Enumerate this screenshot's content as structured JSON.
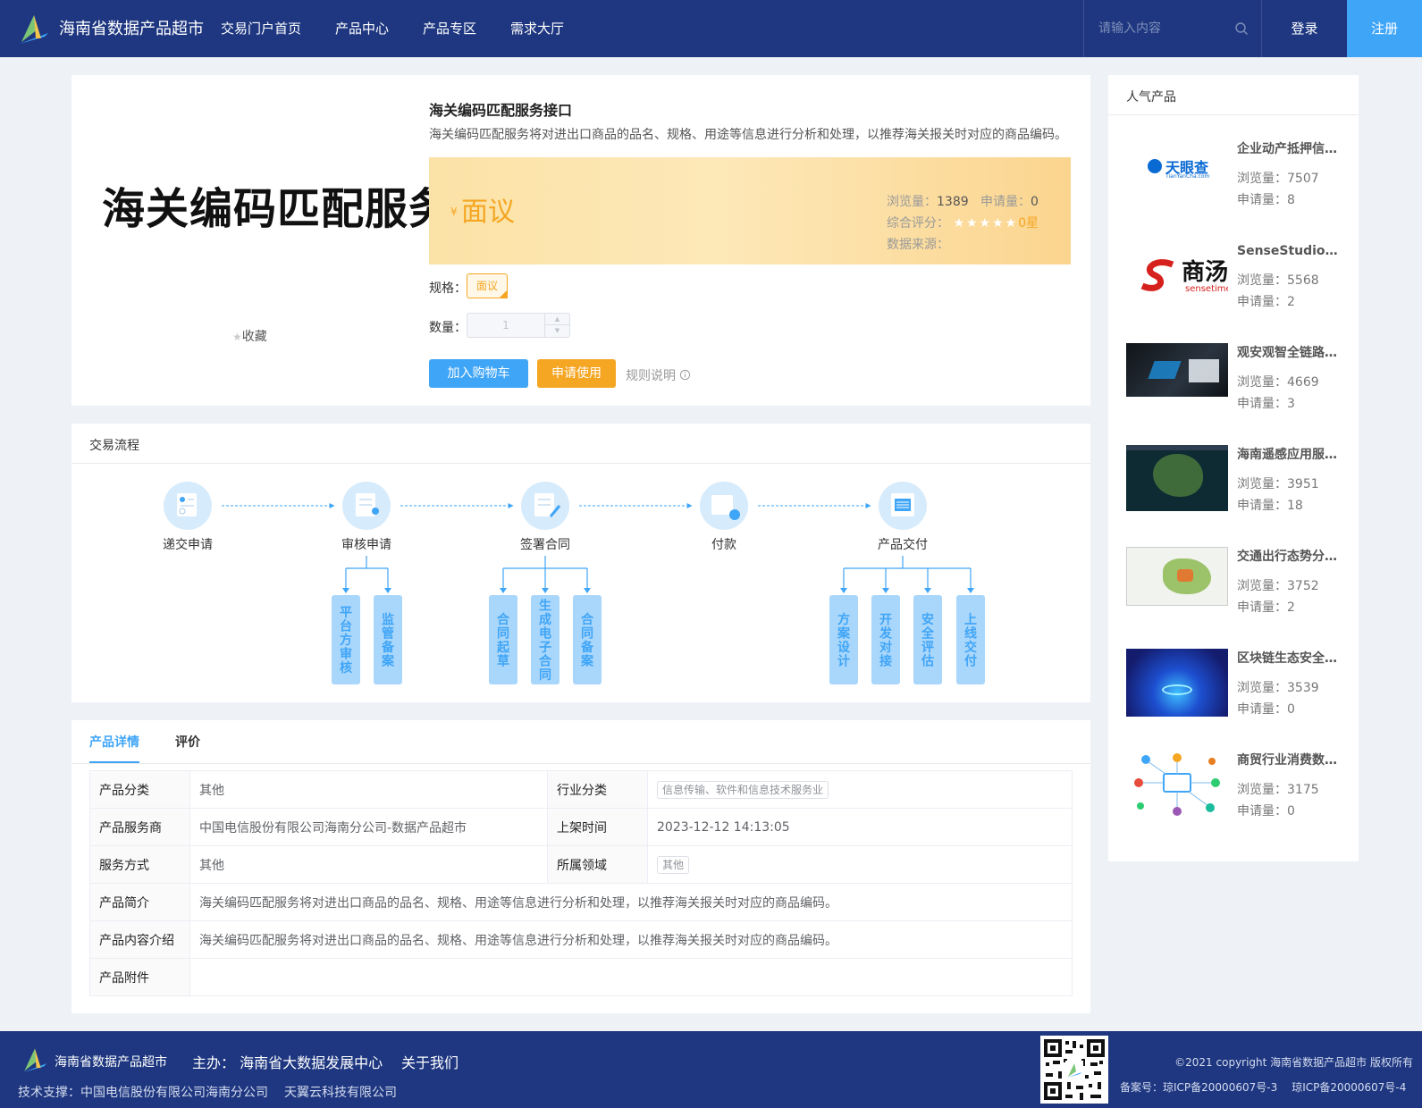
{
  "header": {
    "brand": "海南省数据产品超市",
    "nav": [
      "交易门户首页",
      "产品中心",
      "产品专区",
      "需求大厅"
    ],
    "search_placeholder": "请输入内容",
    "login": "登录",
    "register": "注册"
  },
  "product": {
    "image_text": "海关编码匹配服务",
    "favorite": "收藏",
    "title": "海关编码匹配服务接口",
    "description": "海关编码匹配服务将对进出口商品的品名、规格、用途等信息进行分析和处理，以推荐海关报关时对应的商品编码。",
    "currency": "¥",
    "price": "面议",
    "views_label": "浏览量：",
    "views": "1389",
    "applies_label": "申请量：",
    "applies": "0",
    "rating_label": "综合评分：",
    "stars": "★★★★★",
    "rating": "0星",
    "source_label": "数据来源：",
    "spec_label": "规格：",
    "spec_value": "面议",
    "qty_label": "数量：",
    "qty_value": "1",
    "add_cart": "加入购物车",
    "apply": "申请使用",
    "rules": "规则说明"
  },
  "flow": {
    "title": "交易流程",
    "steps": [
      "递交申请",
      "审核申请",
      "签署合同",
      "付款",
      "产品交付"
    ],
    "sub": {
      "audit": [
        "平台方审核",
        "监管备案"
      ],
      "contract": [
        "合同起草",
        "生成电子合同",
        "合同备案"
      ],
      "deliver": [
        "方案设计",
        "开发对接",
        "安全评估",
        "上线交付"
      ]
    }
  },
  "details": {
    "tabs": [
      "产品详情",
      "评价"
    ],
    "rows": {
      "category_k": "产品分类",
      "category_v": "其他",
      "industry_k": "行业分类",
      "industry_v": "信息传输、软件和信息技术服务业",
      "provider_k": "产品服务商",
      "provider_v": "中国电信股份有限公司海南分公司-数据产品超市",
      "online_k": "上架时间",
      "online_v": "2023-12-12 14:13:05",
      "mode_k": "服务方式",
      "mode_v": "其他",
      "domain_k": "所属领域",
      "domain_v": "其他",
      "intro_k": "产品简介",
      "intro_v": "海关编码匹配服务将对进出口商品的品名、规格、用途等信息进行分析和处理，以推荐海关报关时对应的商品编码。",
      "content_k": "产品内容介绍",
      "content_v": "海关编码匹配服务将对进出口商品的品名、规格、用途等信息进行分析和处理，以推荐海关报关时对应的商品编码。",
      "attach_k": "产品附件"
    }
  },
  "sidebar": {
    "title": "人气产品",
    "items": [
      {
        "name": "企业动产抵押信息查询",
        "views": "浏览量：7507",
        "applies": "申请量：8",
        "thumb_text": "天眼查",
        "thumb_sub": "TianYanCha.com"
      },
      {
        "name": "SenseStudio人工智能平台",
        "views": "浏览量：5568",
        "applies": "申请量：2",
        "thumb_text": "商汤",
        "thumb_sub": "sensetime"
      },
      {
        "name": "观安观智全链路数据安全",
        "views": "浏览量：4669",
        "applies": "申请量：3"
      },
      {
        "name": "海南遥感应用服务平台",
        "views": "浏览量：3951",
        "applies": "申请量：18"
      },
      {
        "name": "交通出行态势分析服务",
        "views": "浏览量：3752",
        "applies": "申请量：2"
      },
      {
        "name": "区块链生态安全服务",
        "views": "浏览量：3539",
        "applies": "申请量：0"
      },
      {
        "name": "商贸行业消费数据服务",
        "views": "浏览量：3175",
        "applies": "申请量：0"
      }
    ]
  },
  "footer": {
    "brand": "海南省数据产品超市",
    "host": "主办： 海南省大数据发展中心",
    "about": "关于我们",
    "tech1": "技术支撑：中国电信股份有限公司海南分公司",
    "tech2": "天翼云科技有限公司",
    "copyright": "©2021 copyright 海南省数据产品超市 版权所有",
    "icp1": "备案号：琼ICP备20000607号-3",
    "icp2": "琼ICP备20000607号-4"
  },
  "colors": {
    "header_bg": "#1e3780",
    "accent": "#3fa5f7",
    "price": "#f5a623"
  }
}
